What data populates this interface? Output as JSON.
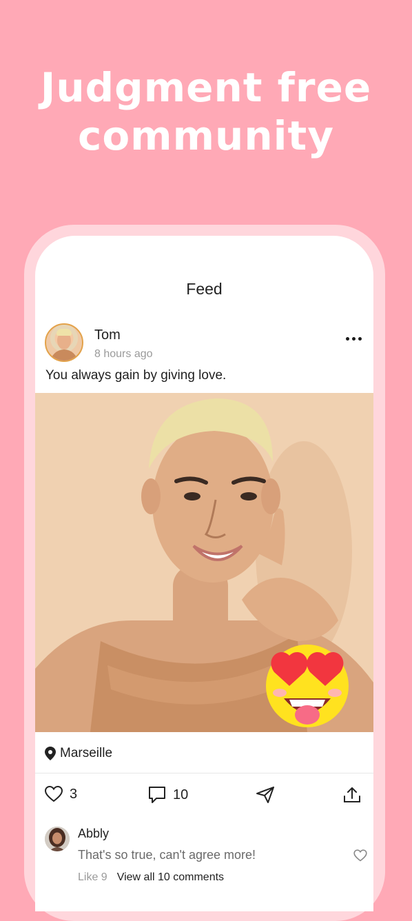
{
  "headline": {
    "line1": "Judgment free",
    "line2": "community"
  },
  "nav": {
    "title": "Feed"
  },
  "post": {
    "author": "Tom",
    "time": "8 hours ago",
    "caption": "You always gain by giving love.",
    "location": "Marseille",
    "likes": "3",
    "comments": "10",
    "icons": {
      "more": "more-horizontal-icon",
      "location": "location-pin-icon",
      "like": "heart-outline-icon",
      "comment": "speech-bubble-icon",
      "send": "paper-plane-icon",
      "share": "share-upload-icon",
      "sticker": "heart-eyes-emoji"
    }
  },
  "comment": {
    "author": "Abbly",
    "text": "That's so true, can't agree more!",
    "like_count_label": "Like 9",
    "view_all_label": "View all 10 comments"
  },
  "colors": {
    "background": "#ffa9b6",
    "frame": "#ffd6dc",
    "avatar_ring": "#e3a24a",
    "photo_bg": "#f2d3b3"
  }
}
